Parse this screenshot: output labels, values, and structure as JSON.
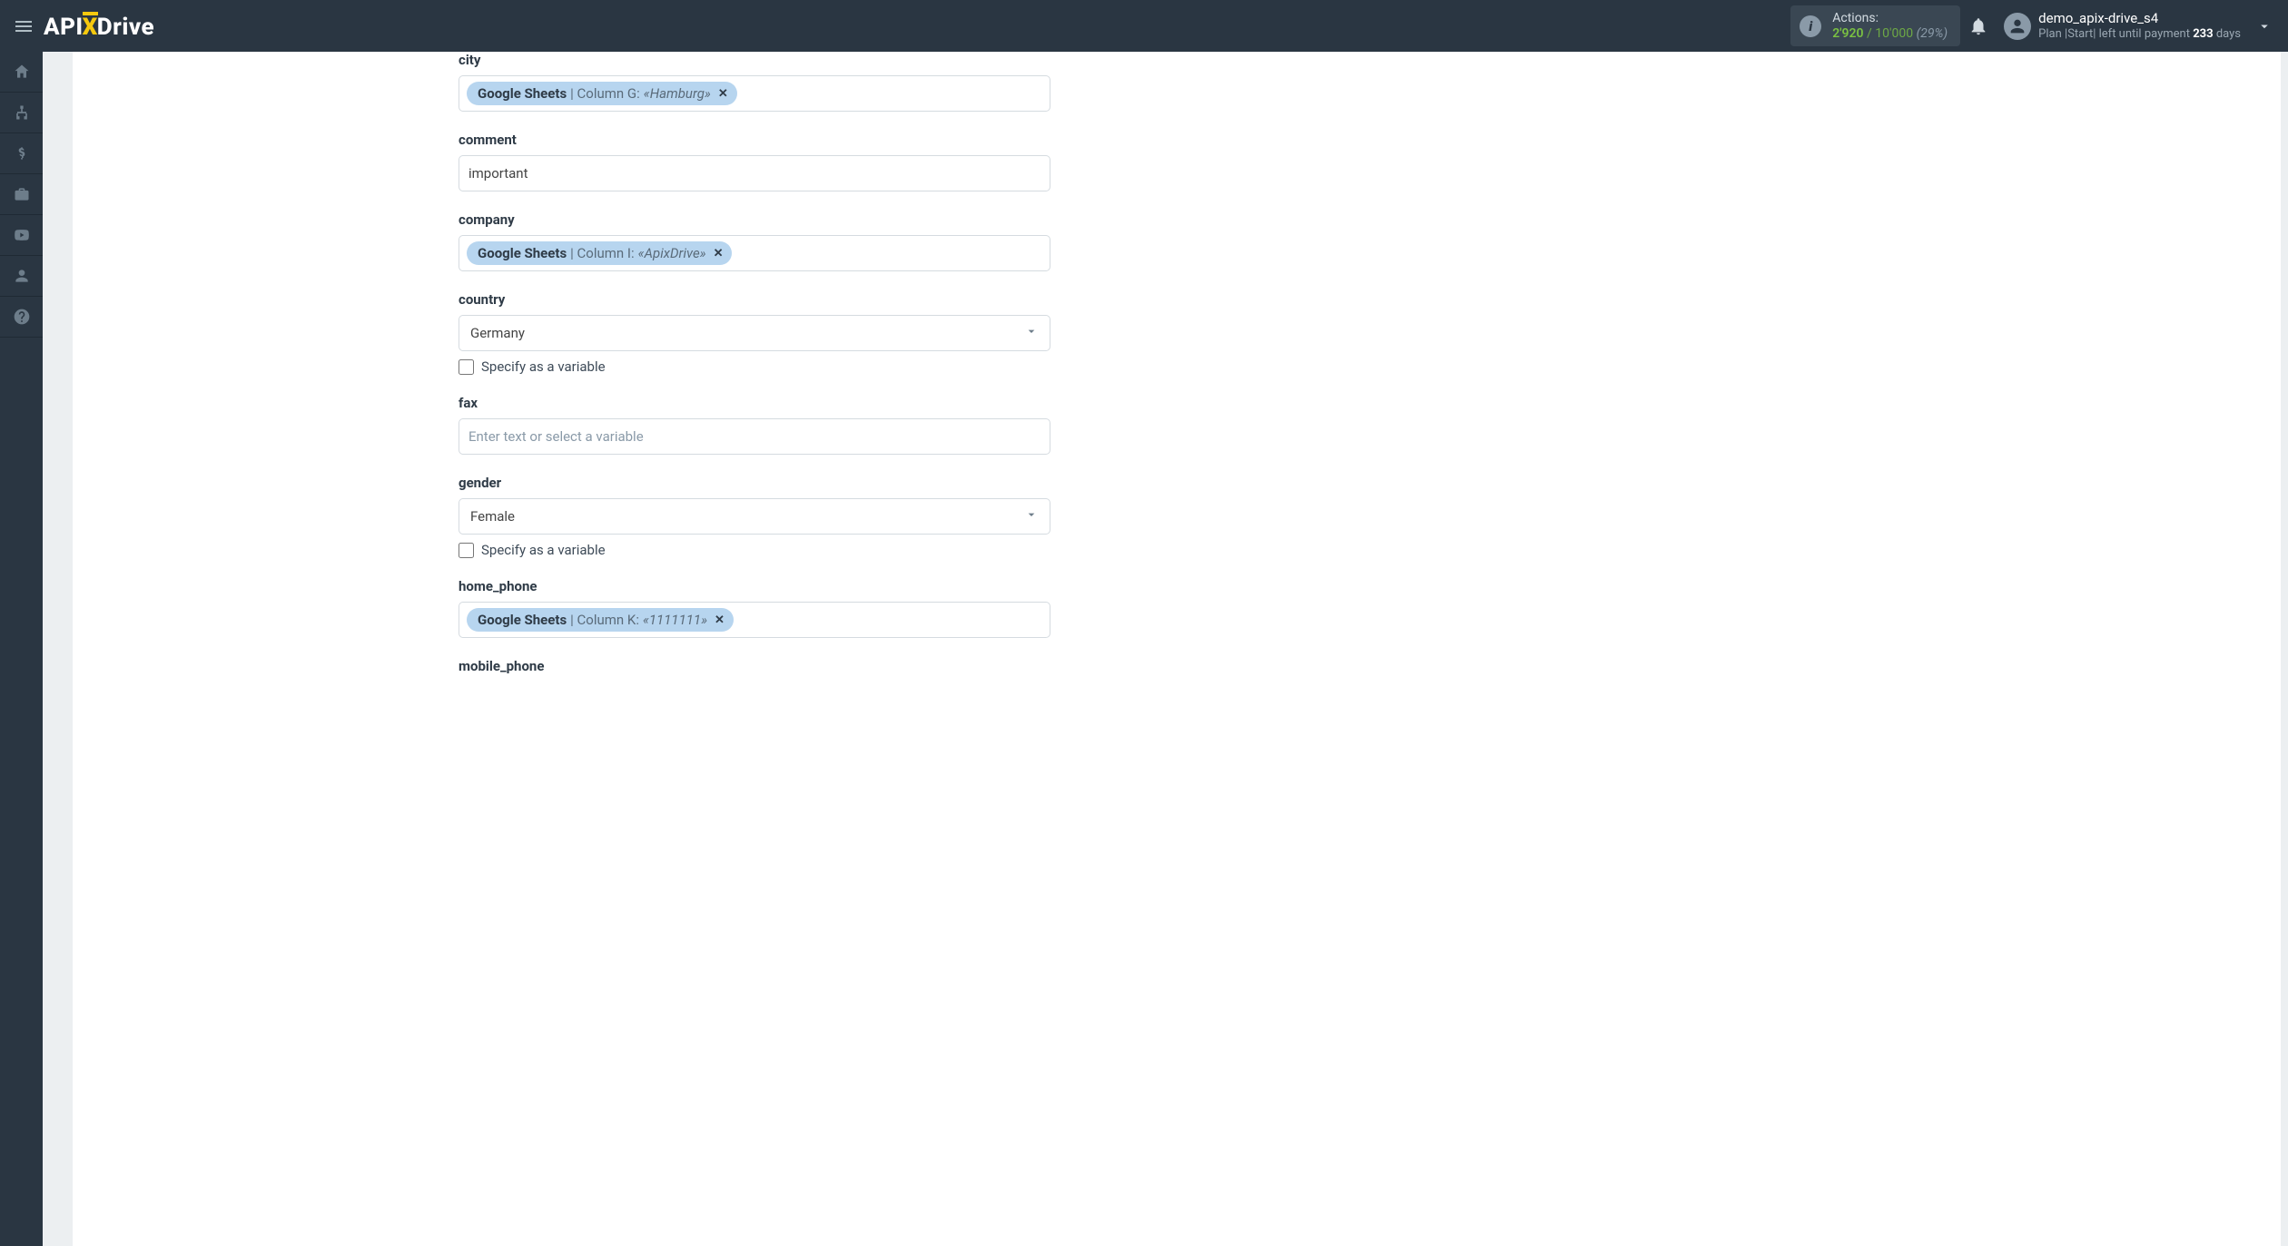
{
  "header": {
    "logo_parts": {
      "api": "API",
      "x": "X",
      "drive": "Drive"
    },
    "actions": {
      "label": "Actions:",
      "used": "2'920",
      "sep": "/",
      "limit": "10'000",
      "pct": "(29%)"
    },
    "user": {
      "username": "demo_apix-drive_s4",
      "plan_prefix": "Plan |",
      "plan_name": "Start",
      "plan_mid": "| left until payment ",
      "days_count": "233",
      "days_suffix": " days"
    }
  },
  "rail": {
    "items": [
      "home",
      "sitemap",
      "dollar",
      "briefcase",
      "youtube",
      "user",
      "help"
    ]
  },
  "fields": {
    "city": {
      "label": "city",
      "token_src": "Google Sheets",
      "token_mid": " | Column G: ",
      "token_val": "«Hamburg»"
    },
    "comment": {
      "label": "comment",
      "value": "important"
    },
    "company": {
      "label": "company",
      "token_src": "Google Sheets",
      "token_mid": " | Column I: ",
      "token_val": "«ApixDrive»"
    },
    "country": {
      "label": "country",
      "selected": "Germany",
      "specify_label": "Specify as a variable"
    },
    "fax": {
      "label": "fax",
      "placeholder": "Enter text or select a variable"
    },
    "gender": {
      "label": "gender",
      "selected": "Female",
      "specify_label": "Specify as a variable"
    },
    "home_phone": {
      "label": "home_phone",
      "token_src": "Google Sheets",
      "token_mid": " | Column K: ",
      "token_val": "«1111111»"
    },
    "mobile_phone": {
      "label": "mobile_phone"
    }
  }
}
